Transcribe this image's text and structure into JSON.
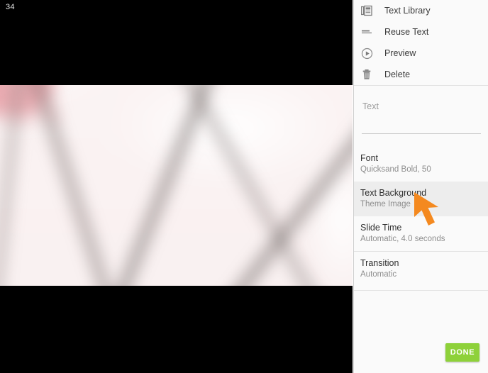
{
  "stage": {
    "slide_counter": "34",
    "image_name": "cherry-blossom-photo",
    "image_description": "Blurred cherry blossom branches, pink flowers on white sky"
  },
  "panel": {
    "menu": [
      {
        "icon": "text-library-icon",
        "label": "Text Library"
      },
      {
        "icon": "reuse-text-icon",
        "label": "Reuse Text"
      },
      {
        "icon": "play-circle-icon",
        "label": "Preview"
      },
      {
        "icon": "trash-icon",
        "label": "Delete"
      }
    ],
    "text_field": {
      "placeholder": "Text",
      "value": ""
    },
    "settings": [
      {
        "title": "Font",
        "value": "Quicksand Bold, 50",
        "selected": false
      },
      {
        "title": "Text Background",
        "value": "Theme Image",
        "selected": true
      },
      {
        "title": "Slide Time",
        "value": "Automatic, 4.0 seconds",
        "selected": false
      },
      {
        "title": "Transition",
        "value": "Automatic",
        "selected": false
      }
    ],
    "done_label": "DONE"
  },
  "colors": {
    "accent_green": "#8ed13a",
    "cursor_orange": "#f4891f",
    "panel_background": "#fafafa",
    "selected_row": "#ededed",
    "stage_background": "#000000"
  },
  "cursor": {
    "name": "mouse-pointer-arrow",
    "color": "#f4891f"
  }
}
